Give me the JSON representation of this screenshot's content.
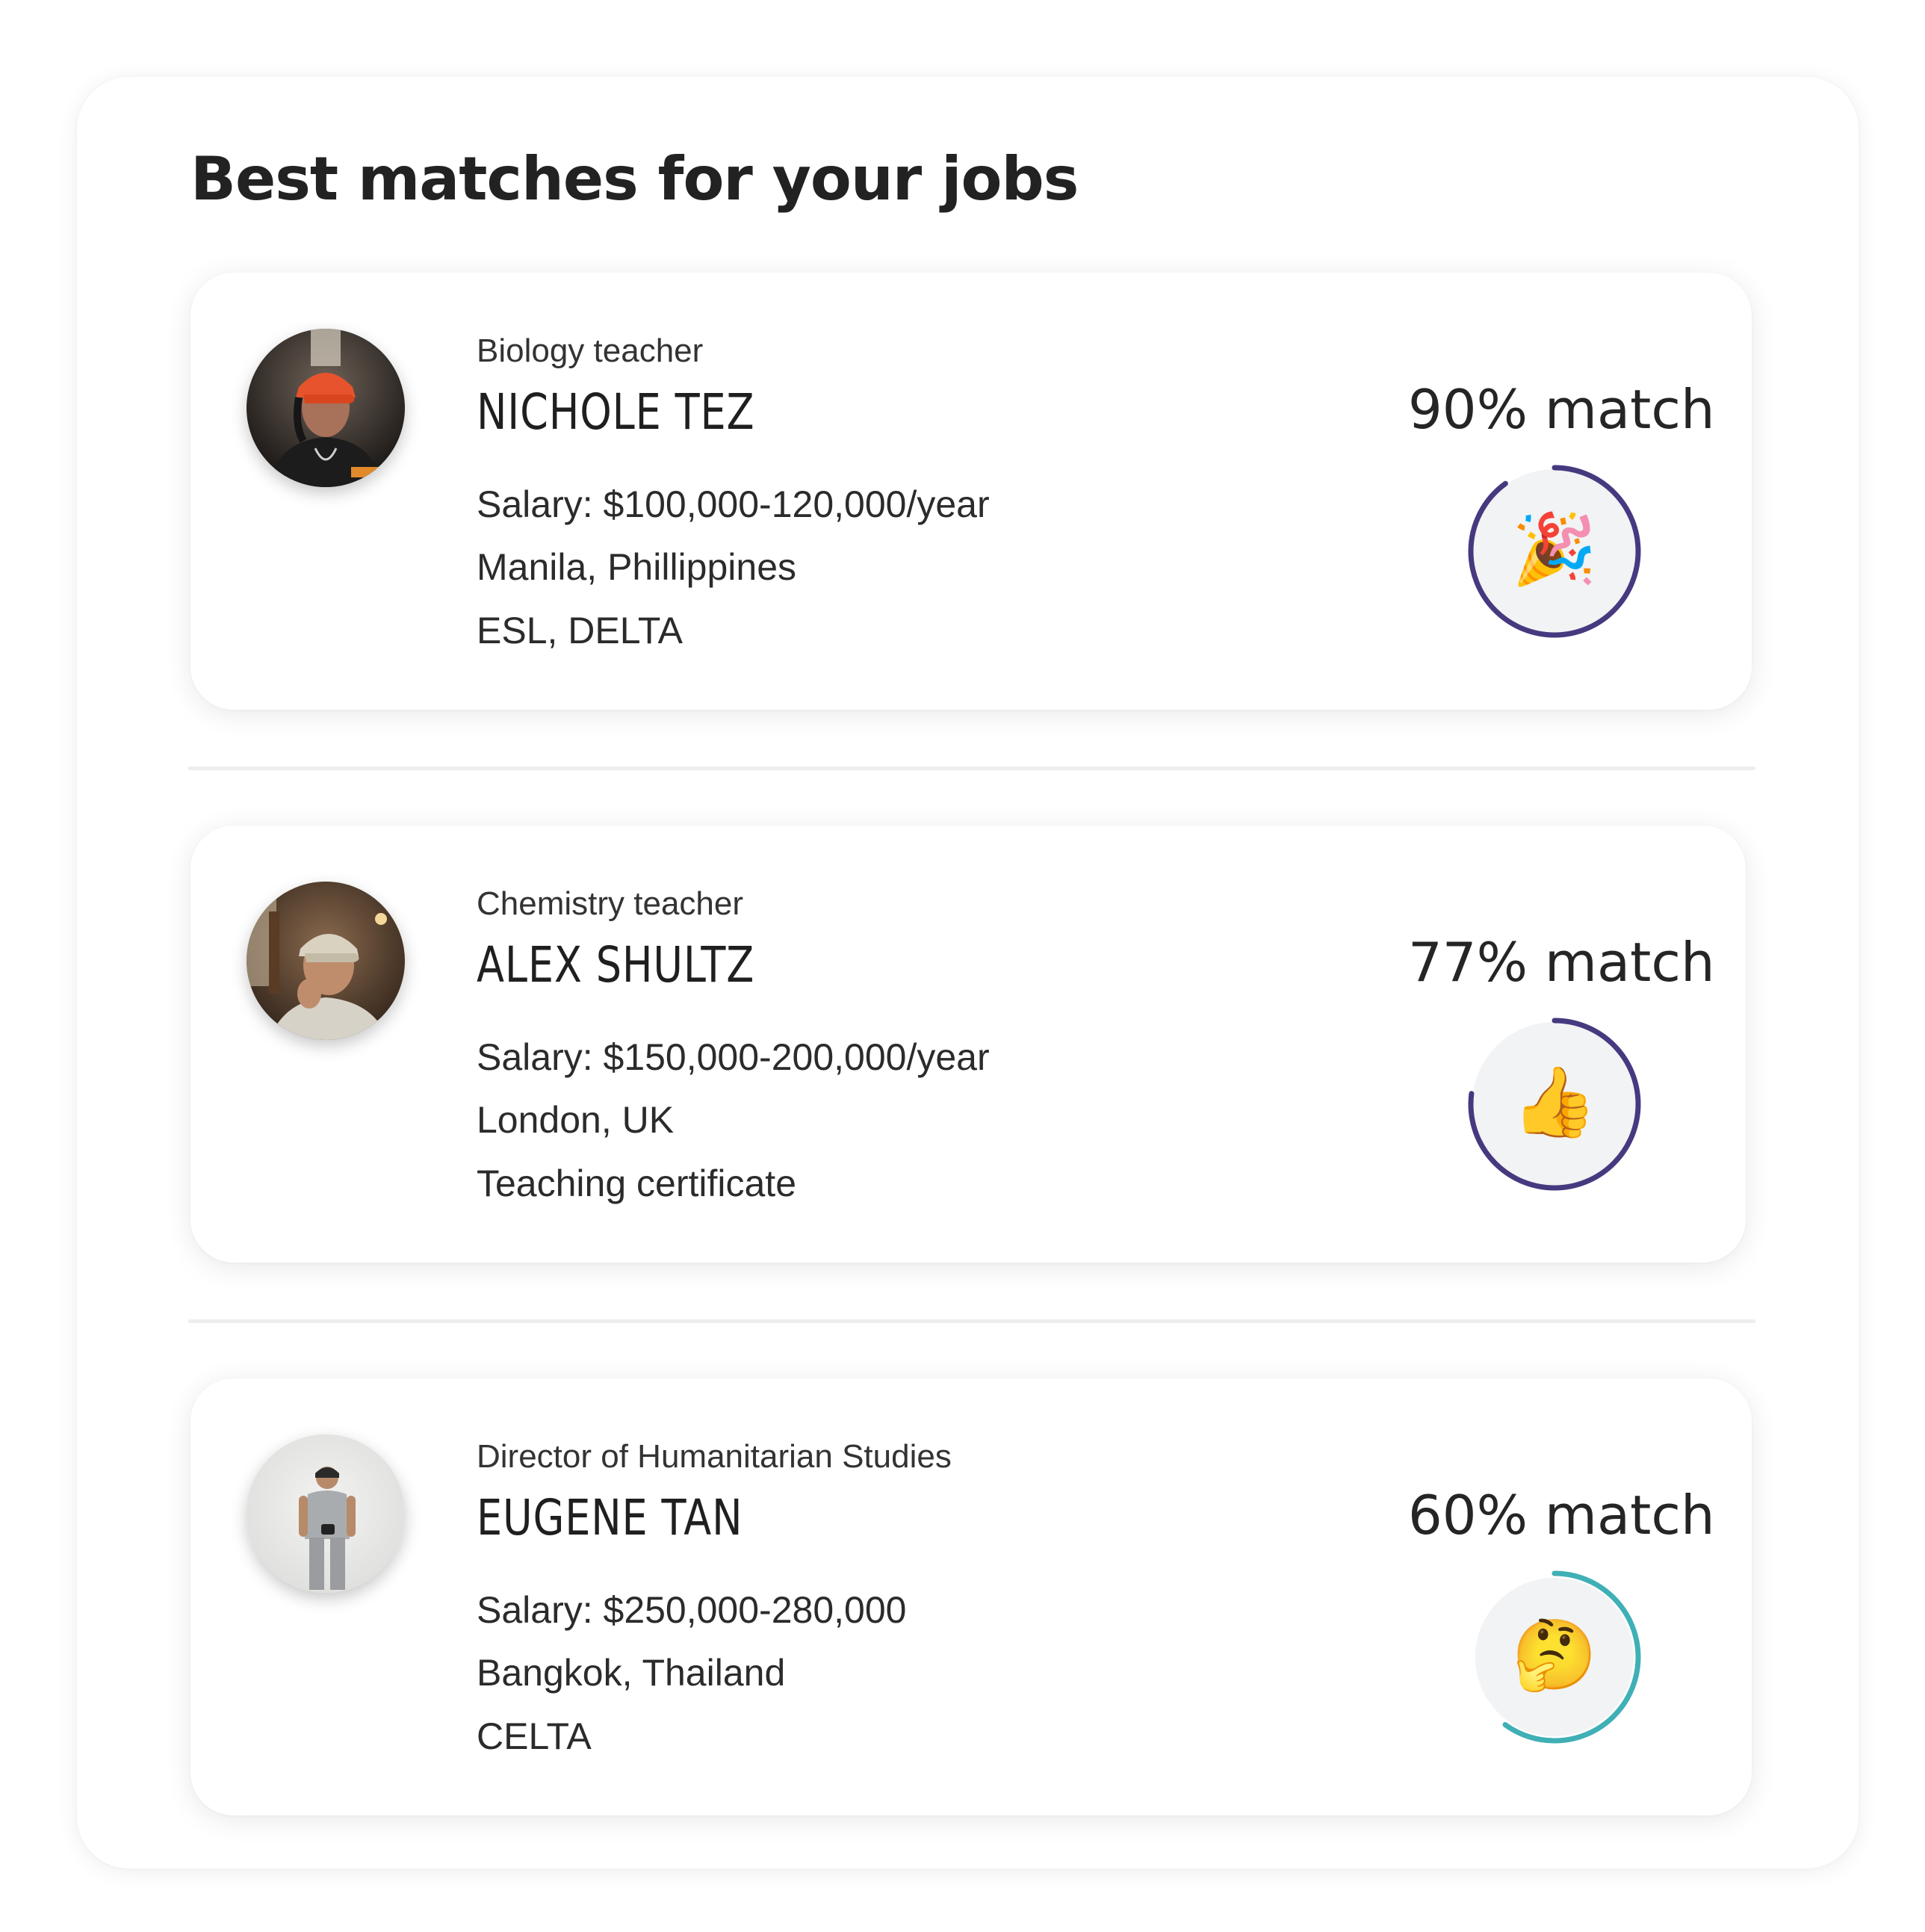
{
  "header": {
    "title": "Best matches for your jobs"
  },
  "colors": {
    "ring_purple": "#46397f",
    "ring_teal": "#3fb0b5",
    "ring_fill": "#f1f3f4"
  },
  "matches": [
    {
      "job_title": "Biology teacher",
      "name": "NICHOLE TEZ",
      "salary": "Salary: $100,000-120,000/year",
      "location": "Manila, Phillippines",
      "qualifications": "ESL, DELTA",
      "match_label": "90% match",
      "match_percent": 90,
      "ring_color": "#46397f",
      "emoji_icon": "party-popper-icon",
      "emoji": "🎉"
    },
    {
      "job_title": "Chemistry teacher",
      "name": "ALEX SHULTZ",
      "salary": "Salary: $150,000-200,000/year",
      "location": "London, UK",
      "qualifications": "Teaching certificate",
      "match_label": "77% match",
      "match_percent": 77,
      "ring_color": "#46397f",
      "emoji_icon": "thumbs-up-icon",
      "emoji": "👍"
    },
    {
      "job_title": "Director of Humanitarian Studies",
      "name": "EUGENE TAN",
      "salary": "Salary: $250,000-280,000",
      "location": "Bangkok, Thailand",
      "qualifications": "CELTA",
      "match_label": "60% match",
      "match_percent": 60,
      "ring_color": "#3fb0b5",
      "emoji_icon": "thinking-face-icon",
      "emoji": "🤔"
    }
  ]
}
